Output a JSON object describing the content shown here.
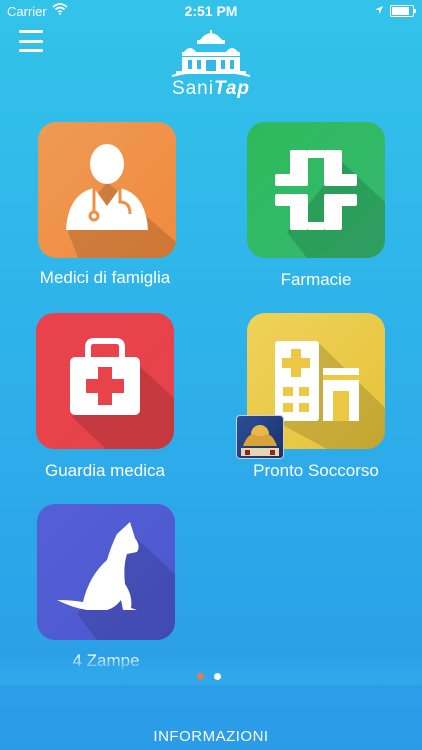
{
  "status_bar": {
    "carrier": "Carrier",
    "time": "2:51 PM",
    "battery_level": 0.85
  },
  "header": {
    "logo_text_plain": "Sani",
    "logo_text_accent": "Tap"
  },
  "tiles": [
    {
      "label": "Medici di famiglia",
      "icon": "doctor-icon",
      "color": "#f09045"
    },
    {
      "label": "Farmacie",
      "icon": "pharmacy-cross-icon",
      "color": "#2fb95f"
    },
    {
      "label": "Guardia medica",
      "icon": "first-aid-kit-icon",
      "color": "#e8434b"
    },
    {
      "label": "Pronto Soccorso",
      "icon": "hospital-building-icon",
      "color": "#ecc845"
    },
    {
      "label": "4 Zampe",
      "icon": "dog-icon",
      "color": "#5059d3"
    }
  ],
  "pager": {
    "pages": 2,
    "current": 2
  },
  "footer": {
    "info_label": "INFORMAZIONI"
  },
  "colors": {
    "background_top": "#33c3e9",
    "background_bottom": "#2a9be8",
    "inactive_dot": "#e07a5a",
    "active_dot": "#ffffff"
  }
}
